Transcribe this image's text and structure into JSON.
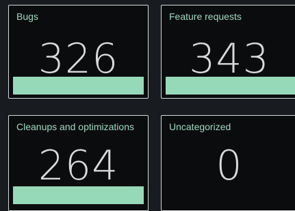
{
  "panels": [
    {
      "title": "Bugs",
      "value": "326",
      "bar_fraction": 1.0,
      "color": "#96d9b9"
    },
    {
      "title": "Feature requests",
      "value": "343",
      "bar_fraction": 1.0,
      "color": "#96d9b9"
    },
    {
      "title": "Cleanups and optimizations",
      "value": "264",
      "bar_fraction": 1.0,
      "color": "#96d9b9"
    },
    {
      "title": "Uncategorized",
      "value": "0",
      "bar_fraction": 0.0,
      "color": "#96d9b9"
    }
  ]
}
